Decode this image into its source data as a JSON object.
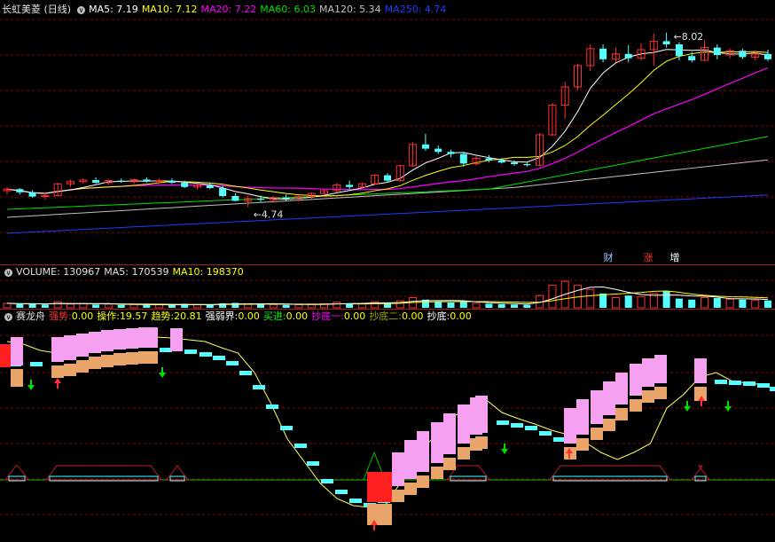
{
  "panel_main": {
    "title": "长虹美菱 (日线)",
    "indicators": [
      {
        "label": "MA5: 7.19",
        "color": "#ffffff"
      },
      {
        "label": "MA10: 7.12",
        "color": "#ffff00"
      },
      {
        "label": "MA20: 7.22",
        "color": "#ff00ff"
      },
      {
        "label": "MA60: 6.03",
        "color": "#00e000"
      },
      {
        "label": "MA120: 5.34",
        "color": "#c0c0c0"
      },
      {
        "label": "MA250: 4.74",
        "color": "#1e3cff"
      }
    ],
    "high_label": "8.02",
    "low_label": "4.74",
    "markers": [
      "财",
      "涨",
      "增"
    ]
  },
  "panel_volume": {
    "title": "VOLUME: 130967",
    "ma5": "MA5: 170539",
    "ma10": "MA10: 198370"
  },
  "panel_indicator": {
    "title": "赛龙舟",
    "fields": [
      {
        "label": "强势:",
        "value": "0.00",
        "color": "#ff3030"
      },
      {
        "label": "操作:",
        "value": "19.57",
        "color": "#ffff00"
      },
      {
        "label": "趋势:",
        "value": "20.81",
        "color": "#ffff00"
      },
      {
        "label": "强弱界:",
        "value": "0.00",
        "color": "#ffffff"
      },
      {
        "label": "买进:",
        "value": "0.00",
        "color": "#00ff00"
      },
      {
        "label": "抄底一:",
        "value": "0.00",
        "color": "#ff00ff"
      },
      {
        "label": "抄底二:",
        "value": "0.00",
        "color": "#a0a000"
      },
      {
        "label": "抄底:",
        "value": "0.00",
        "color": "#ffffff"
      }
    ]
  },
  "colors": {
    "up": "#ff3030",
    "down": "#54ffff",
    "grid": "#8b0000",
    "pink": "#f5a0f0",
    "tan": "#e9a46a"
  },
  "chart_data": {
    "type": "candlestick",
    "series": [
      {
        "o": 5.05,
        "h": 5.12,
        "l": 4.98,
        "c": 5.08
      },
      {
        "o": 5.08,
        "h": 5.1,
        "l": 4.98,
        "c": 5.02
      },
      {
        "o": 5.02,
        "h": 5.06,
        "l": 4.92,
        "c": 4.94
      },
      {
        "o": 4.94,
        "h": 5.02,
        "l": 4.88,
        "c": 4.96
      },
      {
        "o": 4.96,
        "h": 5.2,
        "l": 4.94,
        "c": 5.18
      },
      {
        "o": 5.18,
        "h": 5.26,
        "l": 5.12,
        "c": 5.22
      },
      {
        "o": 5.22,
        "h": 5.28,
        "l": 5.18,
        "c": 5.25
      },
      {
        "o": 5.25,
        "h": 5.3,
        "l": 5.18,
        "c": 5.2
      },
      {
        "o": 5.2,
        "h": 5.26,
        "l": 5.16,
        "c": 5.24
      },
      {
        "o": 5.24,
        "h": 5.28,
        "l": 5.2,
        "c": 5.22
      },
      {
        "o": 5.22,
        "h": 5.28,
        "l": 5.18,
        "c": 5.26
      },
      {
        "o": 5.26,
        "h": 5.3,
        "l": 5.2,
        "c": 5.23
      },
      {
        "o": 5.23,
        "h": 5.28,
        "l": 5.18,
        "c": 5.24
      },
      {
        "o": 5.24,
        "h": 5.28,
        "l": 5.18,
        "c": 5.2
      },
      {
        "o": 5.2,
        "h": 5.24,
        "l": 5.1,
        "c": 5.12
      },
      {
        "o": 5.12,
        "h": 5.18,
        "l": 5.08,
        "c": 5.15
      },
      {
        "o": 5.15,
        "h": 5.2,
        "l": 5.08,
        "c": 5.1
      },
      {
        "o": 5.1,
        "h": 5.14,
        "l": 4.92,
        "c": 4.95
      },
      {
        "o": 4.95,
        "h": 5.0,
        "l": 4.85,
        "c": 4.86
      },
      {
        "o": 4.86,
        "h": 4.96,
        "l": 4.74,
        "c": 4.9
      },
      {
        "o": 4.9,
        "h": 4.96,
        "l": 4.84,
        "c": 4.88
      },
      {
        "o": 4.88,
        "h": 4.95,
        "l": 4.82,
        "c": 4.92
      },
      {
        "o": 4.92,
        "h": 4.98,
        "l": 4.86,
        "c": 4.9
      },
      {
        "o": 4.9,
        "h": 4.96,
        "l": 4.85,
        "c": 4.94
      },
      {
        "o": 4.94,
        "h": 5.02,
        "l": 4.9,
        "c": 5.0
      },
      {
        "o": 5.0,
        "h": 5.08,
        "l": 4.96,
        "c": 5.05
      },
      {
        "o": 5.05,
        "h": 5.2,
        "l": 5.02,
        "c": 5.16
      },
      {
        "o": 5.16,
        "h": 5.24,
        "l": 5.08,
        "c": 5.12
      },
      {
        "o": 5.12,
        "h": 5.2,
        "l": 5.1,
        "c": 5.18
      },
      {
        "o": 5.18,
        "h": 5.36,
        "l": 5.16,
        "c": 5.34
      },
      {
        "o": 5.34,
        "h": 5.38,
        "l": 5.2,
        "c": 5.24
      },
      {
        "o": 5.24,
        "h": 5.54,
        "l": 5.22,
        "c": 5.52
      },
      {
        "o": 5.52,
        "h": 5.96,
        "l": 5.5,
        "c": 5.92
      },
      {
        "o": 5.92,
        "h": 6.12,
        "l": 5.8,
        "c": 5.84
      },
      {
        "o": 5.84,
        "h": 5.9,
        "l": 5.74,
        "c": 5.78
      },
      {
        "o": 5.78,
        "h": 5.82,
        "l": 5.68,
        "c": 5.74
      },
      {
        "o": 5.74,
        "h": 5.78,
        "l": 5.5,
        "c": 5.56
      },
      {
        "o": 5.56,
        "h": 5.7,
        "l": 5.52,
        "c": 5.66
      },
      {
        "o": 5.66,
        "h": 5.72,
        "l": 5.58,
        "c": 5.62
      },
      {
        "o": 5.62,
        "h": 5.66,
        "l": 5.56,
        "c": 5.58
      },
      {
        "o": 5.58,
        "h": 5.62,
        "l": 5.52,
        "c": 5.55
      },
      {
        "o": 5.55,
        "h": 5.58,
        "l": 5.5,
        "c": 5.53
      },
      {
        "o": 5.53,
        "h": 6.14,
        "l": 5.52,
        "c": 6.1
      },
      {
        "o": 6.1,
        "h": 6.7,
        "l": 6.08,
        "c": 6.66
      },
      {
        "o": 6.66,
        "h": 7.1,
        "l": 6.4,
        "c": 7.0
      },
      {
        "o": 7.0,
        "h": 7.44,
        "l": 6.94,
        "c": 7.4
      },
      {
        "o": 7.4,
        "h": 7.8,
        "l": 7.3,
        "c": 7.72
      },
      {
        "o": 7.72,
        "h": 7.8,
        "l": 7.46,
        "c": 7.52
      },
      {
        "o": 7.52,
        "h": 7.74,
        "l": 7.46,
        "c": 7.62
      },
      {
        "o": 7.62,
        "h": 7.78,
        "l": 7.46,
        "c": 7.54
      },
      {
        "o": 7.54,
        "h": 7.82,
        "l": 7.5,
        "c": 7.7
      },
      {
        "o": 7.7,
        "h": 8.0,
        "l": 7.4,
        "c": 7.86
      },
      {
        "o": 7.86,
        "h": 8.02,
        "l": 7.74,
        "c": 7.8
      },
      {
        "o": 7.8,
        "h": 7.84,
        "l": 7.5,
        "c": 7.58
      },
      {
        "o": 7.58,
        "h": 7.66,
        "l": 7.46,
        "c": 7.5
      },
      {
        "o": 7.5,
        "h": 7.88,
        "l": 7.48,
        "c": 7.74
      },
      {
        "o": 7.74,
        "h": 7.8,
        "l": 7.52,
        "c": 7.6
      },
      {
        "o": 7.6,
        "h": 7.72,
        "l": 7.54,
        "c": 7.68
      },
      {
        "o": 7.68,
        "h": 7.72,
        "l": 7.52,
        "c": 7.56
      },
      {
        "o": 7.56,
        "h": 7.68,
        "l": 7.5,
        "c": 7.62
      },
      {
        "o": 7.62,
        "h": 7.7,
        "l": 7.48,
        "c": 7.52
      }
    ],
    "volume": [
      22,
      18,
      20,
      16,
      30,
      18,
      20,
      16,
      18,
      14,
      16,
      14,
      15,
      14,
      20,
      16,
      14,
      22,
      24,
      20,
      18,
      16,
      14,
      15,
      18,
      20,
      28,
      22,
      20,
      30,
      22,
      34,
      50,
      40,
      30,
      26,
      28,
      22,
      20,
      18,
      16,
      15,
      60,
      110,
      130,
      110,
      90,
      70,
      50,
      60,
      55,
      70,
      80,
      45,
      40,
      50,
      48,
      42,
      40,
      38,
      36
    ],
    "volume_up_flags": [
      1,
      0,
      0,
      0,
      1,
      1,
      1,
      0,
      1,
      0,
      1,
      0,
      1,
      0,
      0,
      1,
      0,
      0,
      0,
      1,
      0,
      1,
      0,
      1,
      1,
      1,
      1,
      0,
      1,
      1,
      0,
      1,
      1,
      0,
      0,
      0,
      0,
      1,
      0,
      0,
      0,
      0,
      1,
      1,
      1,
      1,
      1,
      0,
      1,
      0,
      1,
      1,
      0,
      0,
      0,
      1,
      0,
      1,
      0,
      1,
      0
    ]
  }
}
